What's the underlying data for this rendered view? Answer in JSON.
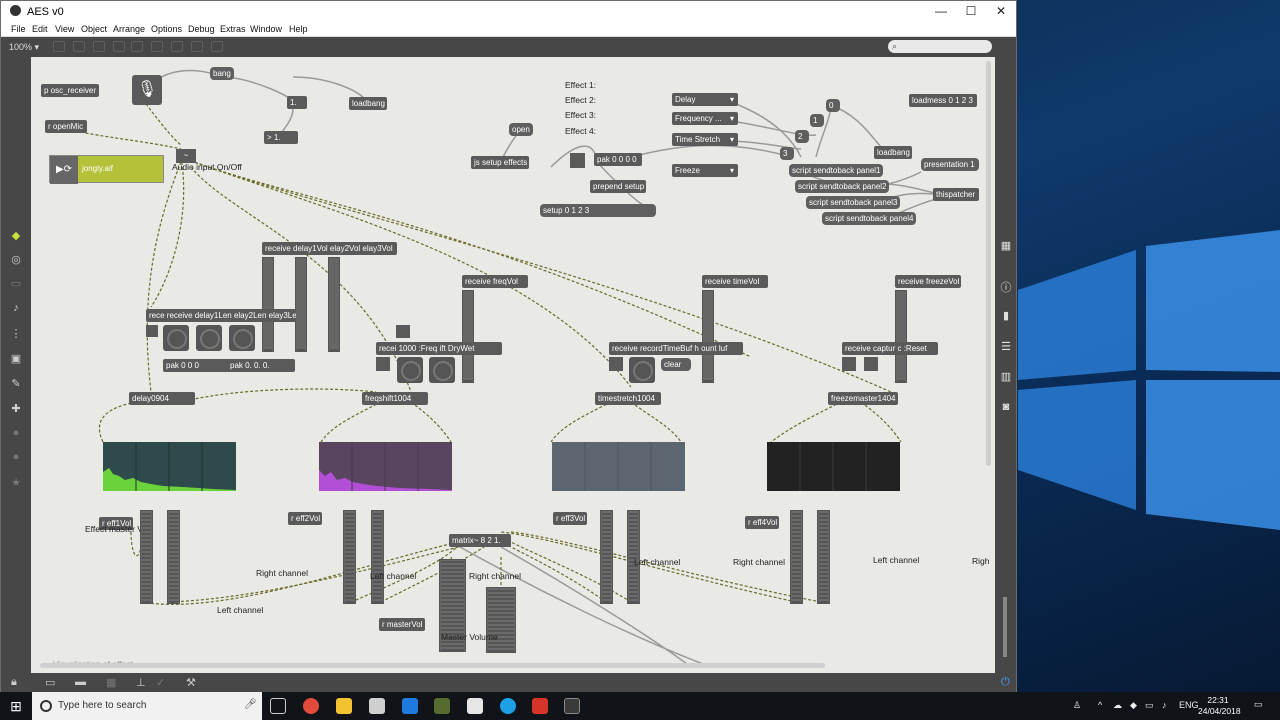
{
  "window": {
    "title": "AES v0",
    "minimize": "—",
    "maximize": "☐",
    "close": "✕"
  },
  "menu": [
    "File",
    "Edit",
    "View",
    "Object",
    "Arrange",
    "Options",
    "Debug",
    "Extras",
    "Window",
    "Help"
  ],
  "toolbar": {
    "zoom": "100% ▾",
    "search_icon": "magnifier-icon"
  },
  "patch": {
    "objects": {
      "osc": "p osc_receiver",
      "openmic": "r openMic",
      "bang": "bang",
      "num1": "1.",
      "gt1": "> 1.",
      "loadbang1": "loadbang",
      "audiofile": "jongly.aif",
      "open": "open",
      "jsfx": "js setup effects",
      "pak0000": "pak 0 0 0 0",
      "prependsetup": "prepend setup",
      "setup0123": "setup 0 1 2 3",
      "delay_menu": "Delay",
      "freq_menu": "Frequency ...",
      "time_menu": "Time Stretch",
      "freeze_menu": "Freeze",
      "m0": "0",
      "m1": "1",
      "m2": "2",
      "m3": "3",
      "loadbang2": "loadbang",
      "sst1": "script sendtoback panel1",
      "sst2": "script sendtoback panel2",
      "sst3": "script sendtoback panel3",
      "sst4": "script sendtoback panel4",
      "loadmess": "loadmess 0 1 2 3",
      "presentation": "presentation 1",
      "thispatcher": "thispatcher",
      "recv_delayvol": "receive delay1Vol  elay2Vol  elay3Vol",
      "recv_delaylen": "rece receive delay1Len  elay2Len  elay3Len",
      "pak000": "pak 0 0 0",
      "pak000b": "pak 0. 0. 0.",
      "delay0904": "delay0904",
      "recv_freqvol": "receive freqVol",
      "recv_freq": "recei 1000   :Freq  ift      DryWet",
      "freqshift": "freqshift1004",
      "recv_timevol": "receive timeVol",
      "recv_record": "receive recordTimeBuf  h  ount  luf",
      "clear": "clear",
      "timestretch": "timestretch1004",
      "recv_freezevol": "receive freezeVol",
      "recv_capture": "receive captur    c  :Reset",
      "freezemaster": "freezemaster1404",
      "eff1": "r eff1Vol",
      "eff2": "r eff2Vol",
      "eff3": "r eff3Vol",
      "eff4": "r eff4Vol",
      "matrix": "matrix~ 8 2 1.",
      "mastervol": "r masterVol"
    },
    "comments": {
      "audio_input": "Audio input On/Off",
      "effect1": "Effect 1:",
      "effect2": "Effect 2:",
      "effect3": "Effect 3:",
      "effect4": "Effect 4:",
      "eff_master": "Effect master Vol",
      "right_ch1": "Right channel",
      "left_ch1": "Left channel",
      "left_ch2": "Left channel",
      "right_ch2": "Right channel",
      "left_ch3": "Left channel",
      "right_ch3": "Right channel",
      "left_ch4": "Left channel",
      "right_cut": "Righ",
      "master_volume": "Master Volume",
      "viz": "Visualisation of effect"
    }
  },
  "taskbar": {
    "search_placeholder": "Type here to search",
    "lang": "ENG",
    "time": "22:31",
    "date": "24/04/2018"
  },
  "colors": {
    "canvas": "#e9e9e6",
    "object": "#5a5a5a",
    "spec1": "#2f4a4a",
    "spec1_fill": "#6ad23a",
    "spec2": "#5a4560",
    "spec2_fill": "#b34fd6",
    "spec3": "#5c6670",
    "spec4": "#222222"
  }
}
